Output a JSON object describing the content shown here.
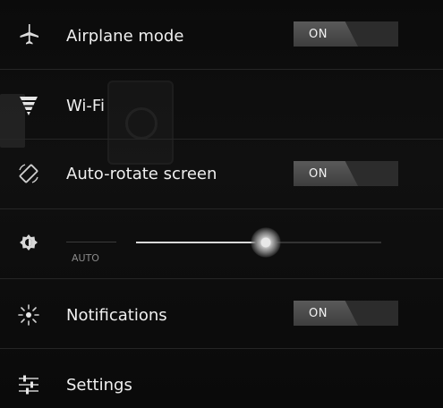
{
  "settings": {
    "airplane": {
      "label": "Airplane mode",
      "toggle": "ON",
      "icon": "airplane-icon"
    },
    "wifi": {
      "label": "Wi-Fi",
      "icon": "wifi-icon"
    },
    "autorotate": {
      "label": "Auto-rotate screen",
      "toggle": "ON",
      "icon": "rotate-icon"
    },
    "brightness": {
      "auto_label": "AUTO",
      "level": 0.53,
      "icon": "brightness-icon"
    },
    "notifications": {
      "label": "Notifications",
      "toggle": "ON",
      "icon": "notifications-icon"
    },
    "settings": {
      "label": "Settings",
      "icon": "settings-sliders-icon"
    }
  },
  "colors": {
    "background": "#0b0b0b",
    "toggle_on": "#4a4a4a",
    "toggle_off": "#2c2c2c",
    "text": "#efefef"
  }
}
